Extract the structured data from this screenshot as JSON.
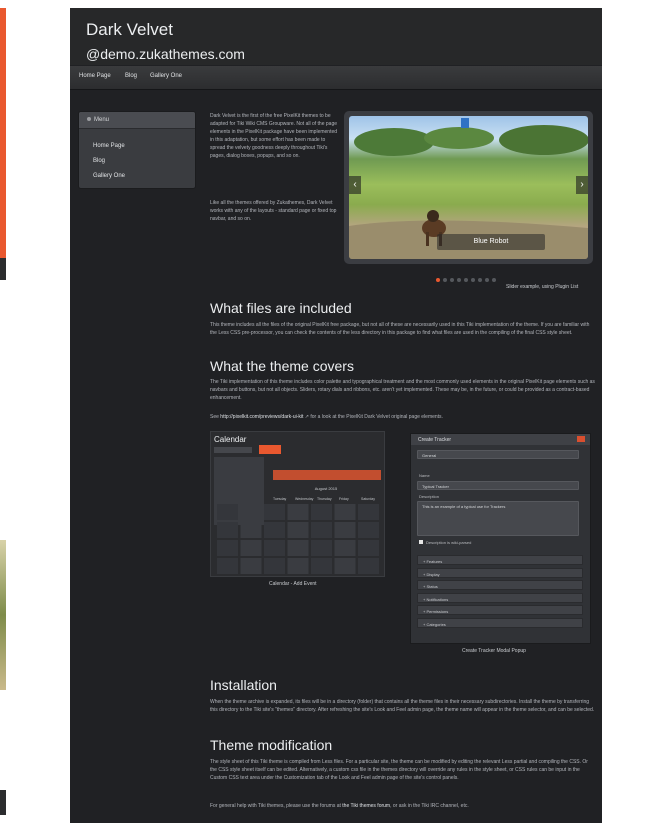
{
  "colors": {
    "accent": "#e9582f",
    "page_bg": "#202124",
    "left_edge": "#e9582f"
  },
  "site": {
    "title": "Dark Velvet",
    "subtitle": "@demo.zukathemes.com"
  },
  "nav": {
    "items": [
      "Home Page",
      "Blog",
      "Gallery One"
    ]
  },
  "menu": {
    "title": "Menu",
    "items": [
      "Home Page",
      "Blog",
      "Gallery One"
    ]
  },
  "intro": {
    "p1": "Dark Velvet is the first of the free PixelKit themes to be adapted for Tiki Wiki CMS Groupware. Not all of the page elements in the PixelKit package have been implemented in this adaptation, but some effort has been made to spread the velvety goodness deeply throughout Tiki's pages, dialog boxes, popups, and so on.",
    "p2": "Like all the themes offered by Zukathemes, Dark Velvet works with any of the layouts - standard page or fixed top navbar, and so on."
  },
  "slider": {
    "caption": "Blue Robot",
    "note": "Slider example, using Plugin List",
    "dot_count": 9,
    "active_dot": 1
  },
  "sections": {
    "files": {
      "heading": "What files are included",
      "body": "This theme includes all the files of the original PixelKit free package, but not all of these are necessarily used in this Tiki implementation of the theme. If you are familiar with the Less CSS pre-processor, you can check the contents of the less directory in this package to find what files are used in the compiling of the final CSS style sheet."
    },
    "covers": {
      "heading": "What the theme covers",
      "body": "The Tiki implementation of this theme includes color palette and typographical treatment and the most commonly used elements in the original PixelKit page elements such as navbars and buttons, but not all objects. Sliders, rotary dials and ribbons, etc. aren't yet implemented. These may be, in the future, or could be provided as a contract-based enhancement.",
      "see_prefix": "See ",
      "see_link": "http://pixelkit.com/previews/dark-ui-kit",
      "see_suffix": " for a look at the PixelKit Dark Velvet original page elements."
    },
    "installation": {
      "heading": "Installation",
      "body": "When the theme archive is expanded, its files will be in a directory (folder) that contains all the theme files in their necessary subdirectories. Install the theme by transferring this directory to the Tiki site's \"themes\" directory. After refreshing the site's Look and Feel admin page, the theme name will appear in the theme selector, and can be selected."
    },
    "modification": {
      "heading": "Theme modification",
      "body": "The style sheet of this Tiki theme is compiled from Less files. For a particular site, the theme can be modified by editing the relevant Less partial and compiling the CSS. Or the CSS style sheet itself can be edited. Alternatively, a custom css file in the themes directory will override any rules in the style sheet, or CSS rules can be input in the Custom CSS text area under the Customization tab of the Look and Feel admin page of the site's control panels.",
      "help_prefix": "For general help with Tiki themes, please use the forums at ",
      "help_link": "the Tiki themes forum",
      "help_suffix": ", or ask in the Tiki IRC channel, etc."
    }
  },
  "calendar": {
    "title": "Calendar",
    "caption": "Calendar - Add Event",
    "month": "August 2015",
    "weekdays": [
      "Tuesday",
      "Wednesday",
      "Thursday",
      "Friday",
      "Saturday"
    ]
  },
  "tracker": {
    "title": "Create Tracker",
    "tab": "General",
    "name_label": "Name",
    "name_value": "Typical Tracker",
    "desc_label": "Description",
    "desc_value": "This is an example of a typical use for Trackers",
    "checkbox_label": "Description is wiki-parsed",
    "sections": [
      "Features",
      "Display",
      "Status",
      "Notifications",
      "Permissions",
      "Categories"
    ],
    "caption": "Create Tracker Modal Popup"
  }
}
